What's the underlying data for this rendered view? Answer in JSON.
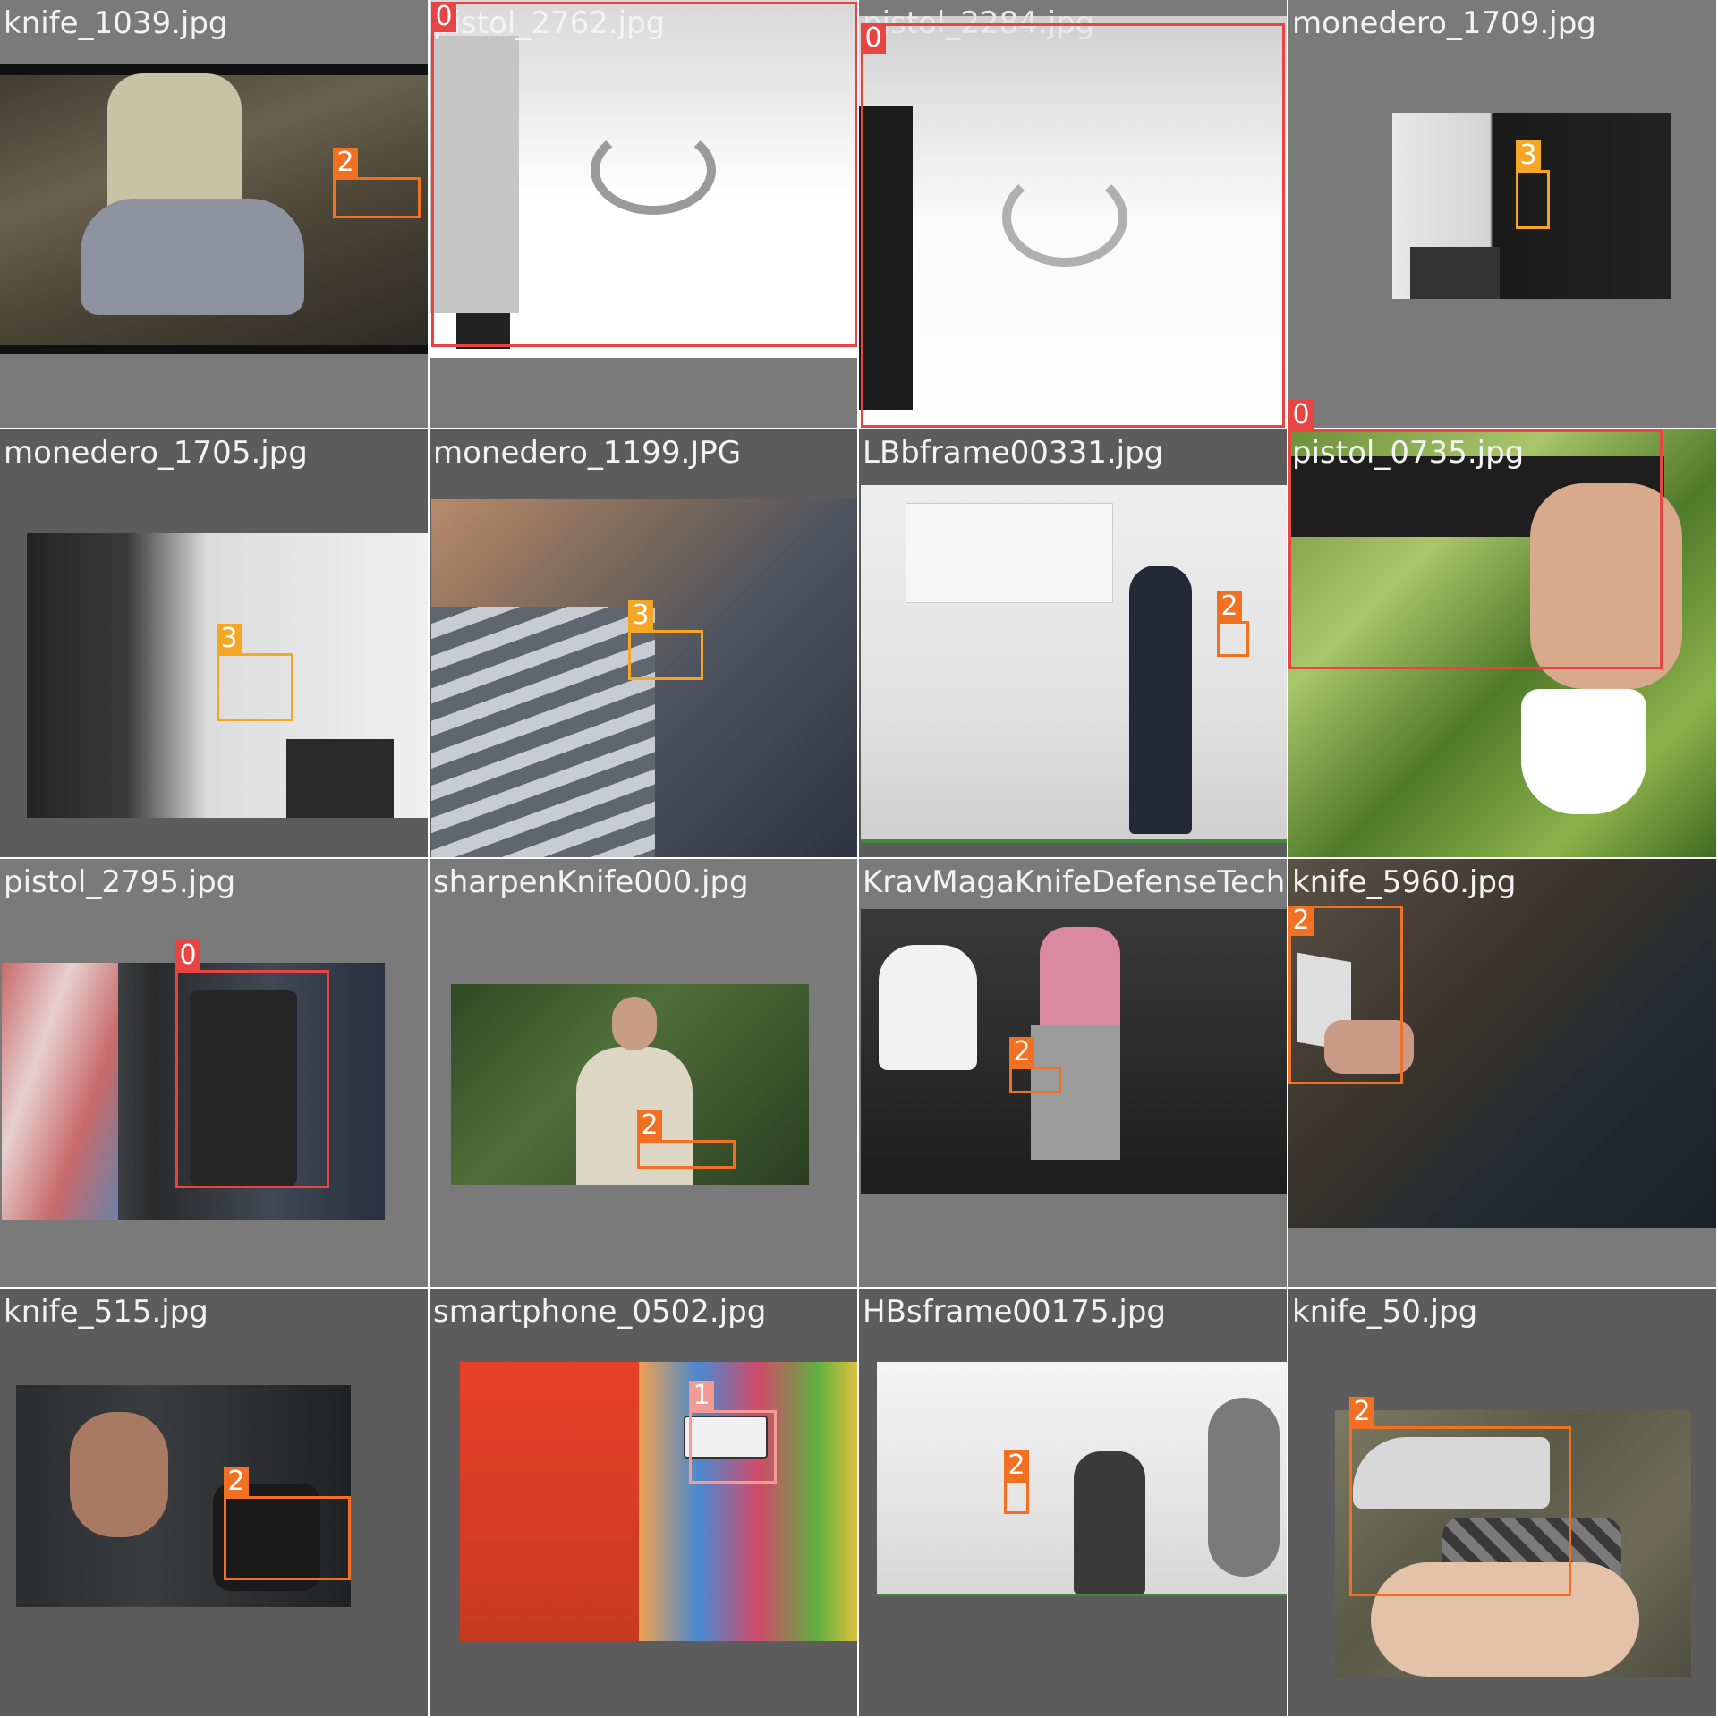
{
  "mosaic": {
    "tiles": [
      {
        "name": "knife_1039.jpg",
        "labels": [
          "2"
        ]
      },
      {
        "name": "pistol_2762.jpg",
        "labels": [
          "0"
        ]
      },
      {
        "name": "pistol_2284.jpg",
        "labels": [
          "0"
        ]
      },
      {
        "name": "monedero_1709.jpg",
        "labels": [
          "3"
        ]
      },
      {
        "name": "monedero_1705.jpg",
        "labels": [
          "3"
        ]
      },
      {
        "name": "monedero_1199.JPG",
        "labels": [
          "3"
        ]
      },
      {
        "name": "LBbframe00331.jpg",
        "labels": [
          "2"
        ]
      },
      {
        "name": "pistol_0735.jpg",
        "labels": [
          "0"
        ]
      },
      {
        "name": "pistol_2795.jpg",
        "labels": [
          "0"
        ]
      },
      {
        "name": "sharpenKnife000.jpg",
        "labels": [
          "2"
        ]
      },
      {
        "name": "KravMagaKnifeDefenseTech",
        "labels": [
          "2"
        ]
      },
      {
        "name": "knife_5960.jpg",
        "labels": [
          "2"
        ]
      },
      {
        "name": "knife_515.jpg",
        "labels": [
          "2"
        ]
      },
      {
        "name": "smartphone_0502.jpg",
        "labels": [
          "1"
        ]
      },
      {
        "name": "HBsframe00175.jpg",
        "labels": [
          "2"
        ]
      },
      {
        "name": "knife_50.jpg",
        "labels": [
          "2"
        ]
      }
    ]
  },
  "colors": {
    "class_0": "#e84444",
    "class_1": "#f39a94",
    "class_2": "#f27022",
    "class_3": "#f5a623",
    "tile_background": "#777777",
    "caption_text": "#f3f3f3"
  }
}
